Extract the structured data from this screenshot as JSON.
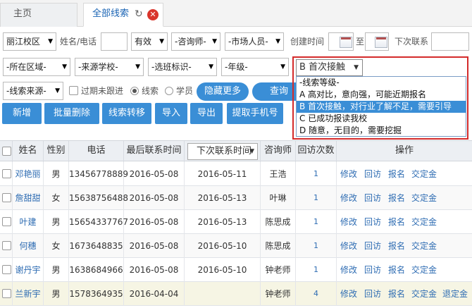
{
  "tabs": {
    "home": "主页",
    "active": "全部线索",
    "refresh_icon": "↻",
    "close_icon": "✕"
  },
  "filters": {
    "campus": "丽江校区",
    "name_phone_label": "姓名/电话",
    "valid": "有效",
    "consultant": "-咨询师-",
    "marketer": "-市场人员-",
    "created_label": "创建时间",
    "to_label": "至",
    "next_contact_label": "下次联系",
    "region": "-所在区域-",
    "school": "-来源学校-",
    "class_tag": "-选班标识-",
    "grade": "-年级-",
    "source": "-线索来源-",
    "overdue_label": "过期未跟进",
    "radio_clue": "线索",
    "radio_student": "学员",
    "hide_more": "隐藏更多",
    "query": "查询"
  },
  "dropdown": {
    "selected": "B 首次接触",
    "options": [
      "-线索等级-",
      "A 高对比，意向强，可能近期报名",
      "B 首次接触，对行业了解不足，需要引导",
      "C 已成功报读我校",
      "D 随意，无目的，需要挖掘"
    ],
    "highlight_index": 2
  },
  "actions": [
    "新增",
    "批量删除",
    "线索转移",
    "导入",
    "导出",
    "提取手机号"
  ],
  "table": {
    "headers": {
      "name": "姓名",
      "gender": "性别",
      "phone": "电话",
      "last_contact": "最后联系时间",
      "next_contact": "下次联系时间",
      "consultant": "咨询师",
      "visits": "回访次数",
      "ops": "操作"
    },
    "rows": [
      {
        "name": "邓艳丽",
        "gender": "男",
        "phone": "13456778889",
        "last": "2016-05-08",
        "next": "2016-05-11",
        "consultant": "王浩",
        "visits": "1",
        "ops": [
          "修改",
          "回访",
          "报名",
          "交定金"
        ]
      },
      {
        "name": "詹甜甜",
        "gender": "女",
        "phone": "15638756488",
        "last": "2016-05-08",
        "next": "2016-05-13",
        "consultant": "叶琳",
        "visits": "1",
        "ops": [
          "修改",
          "回访",
          "报名",
          "交定金"
        ]
      },
      {
        "name": "叶建",
        "gender": "男",
        "phone": "15654337767",
        "last": "2016-05-08",
        "next": "2016-05-13",
        "consultant": "陈思成",
        "visits": "1",
        "ops": [
          "修改",
          "回访",
          "报名",
          "交定金"
        ]
      },
      {
        "name": "何穗",
        "gender": "女",
        "phone": "1673648835",
        "last": "2016-05-08",
        "next": "2016-05-10",
        "consultant": "陈思成",
        "visits": "1",
        "ops": [
          "修改",
          "回访",
          "报名",
          "交定金"
        ]
      },
      {
        "name": "谢丹宇",
        "gender": "男",
        "phone": "1638684966",
        "last": "2016-05-08",
        "next": "2016-05-10",
        "consultant": "钟老师",
        "visits": "1",
        "ops": [
          "修改",
          "回访",
          "报名",
          "交定金"
        ]
      },
      {
        "name": "兰新宇",
        "gender": "男",
        "phone": "1578364935",
        "last": "2016-04-04",
        "next": "",
        "consultant": "钟老师",
        "visits": "4",
        "ops": [
          "修改",
          "回访",
          "报名",
          "交定金",
          "退定金"
        ]
      }
    ]
  }
}
